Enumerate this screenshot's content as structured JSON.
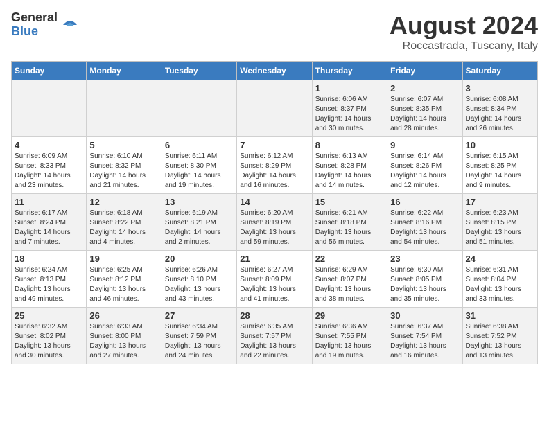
{
  "logo": {
    "general": "General",
    "blue": "Blue"
  },
  "title": "August 2024",
  "subtitle": "Roccastrada, Tuscany, Italy",
  "days_of_week": [
    "Sunday",
    "Monday",
    "Tuesday",
    "Wednesday",
    "Thursday",
    "Friday",
    "Saturday"
  ],
  "weeks": [
    {
      "days": [
        {
          "number": "",
          "info": ""
        },
        {
          "number": "",
          "info": ""
        },
        {
          "number": "",
          "info": ""
        },
        {
          "number": "",
          "info": ""
        },
        {
          "number": "1",
          "info": "Sunrise: 6:06 AM\nSunset: 8:37 PM\nDaylight: 14 hours\nand 30 minutes."
        },
        {
          "number": "2",
          "info": "Sunrise: 6:07 AM\nSunset: 8:35 PM\nDaylight: 14 hours\nand 28 minutes."
        },
        {
          "number": "3",
          "info": "Sunrise: 6:08 AM\nSunset: 8:34 PM\nDaylight: 14 hours\nand 26 minutes."
        }
      ]
    },
    {
      "days": [
        {
          "number": "4",
          "info": "Sunrise: 6:09 AM\nSunset: 8:33 PM\nDaylight: 14 hours\nand 23 minutes."
        },
        {
          "number": "5",
          "info": "Sunrise: 6:10 AM\nSunset: 8:32 PM\nDaylight: 14 hours\nand 21 minutes."
        },
        {
          "number": "6",
          "info": "Sunrise: 6:11 AM\nSunset: 8:30 PM\nDaylight: 14 hours\nand 19 minutes."
        },
        {
          "number": "7",
          "info": "Sunrise: 6:12 AM\nSunset: 8:29 PM\nDaylight: 14 hours\nand 16 minutes."
        },
        {
          "number": "8",
          "info": "Sunrise: 6:13 AM\nSunset: 8:28 PM\nDaylight: 14 hours\nand 14 minutes."
        },
        {
          "number": "9",
          "info": "Sunrise: 6:14 AM\nSunset: 8:26 PM\nDaylight: 14 hours\nand 12 minutes."
        },
        {
          "number": "10",
          "info": "Sunrise: 6:15 AM\nSunset: 8:25 PM\nDaylight: 14 hours\nand 9 minutes."
        }
      ]
    },
    {
      "days": [
        {
          "number": "11",
          "info": "Sunrise: 6:17 AM\nSunset: 8:24 PM\nDaylight: 14 hours\nand 7 minutes."
        },
        {
          "number": "12",
          "info": "Sunrise: 6:18 AM\nSunset: 8:22 PM\nDaylight: 14 hours\nand 4 minutes."
        },
        {
          "number": "13",
          "info": "Sunrise: 6:19 AM\nSunset: 8:21 PM\nDaylight: 14 hours\nand 2 minutes."
        },
        {
          "number": "14",
          "info": "Sunrise: 6:20 AM\nSunset: 8:19 PM\nDaylight: 13 hours\nand 59 minutes."
        },
        {
          "number": "15",
          "info": "Sunrise: 6:21 AM\nSunset: 8:18 PM\nDaylight: 13 hours\nand 56 minutes."
        },
        {
          "number": "16",
          "info": "Sunrise: 6:22 AM\nSunset: 8:16 PM\nDaylight: 13 hours\nand 54 minutes."
        },
        {
          "number": "17",
          "info": "Sunrise: 6:23 AM\nSunset: 8:15 PM\nDaylight: 13 hours\nand 51 minutes."
        }
      ]
    },
    {
      "days": [
        {
          "number": "18",
          "info": "Sunrise: 6:24 AM\nSunset: 8:13 PM\nDaylight: 13 hours\nand 49 minutes."
        },
        {
          "number": "19",
          "info": "Sunrise: 6:25 AM\nSunset: 8:12 PM\nDaylight: 13 hours\nand 46 minutes."
        },
        {
          "number": "20",
          "info": "Sunrise: 6:26 AM\nSunset: 8:10 PM\nDaylight: 13 hours\nand 43 minutes."
        },
        {
          "number": "21",
          "info": "Sunrise: 6:27 AM\nSunset: 8:09 PM\nDaylight: 13 hours\nand 41 minutes."
        },
        {
          "number": "22",
          "info": "Sunrise: 6:29 AM\nSunset: 8:07 PM\nDaylight: 13 hours\nand 38 minutes."
        },
        {
          "number": "23",
          "info": "Sunrise: 6:30 AM\nSunset: 8:05 PM\nDaylight: 13 hours\nand 35 minutes."
        },
        {
          "number": "24",
          "info": "Sunrise: 6:31 AM\nSunset: 8:04 PM\nDaylight: 13 hours\nand 33 minutes."
        }
      ]
    },
    {
      "days": [
        {
          "number": "25",
          "info": "Sunrise: 6:32 AM\nSunset: 8:02 PM\nDaylight: 13 hours\nand 30 minutes."
        },
        {
          "number": "26",
          "info": "Sunrise: 6:33 AM\nSunset: 8:00 PM\nDaylight: 13 hours\nand 27 minutes."
        },
        {
          "number": "27",
          "info": "Sunrise: 6:34 AM\nSunset: 7:59 PM\nDaylight: 13 hours\nand 24 minutes."
        },
        {
          "number": "28",
          "info": "Sunrise: 6:35 AM\nSunset: 7:57 PM\nDaylight: 13 hours\nand 22 minutes."
        },
        {
          "number": "29",
          "info": "Sunrise: 6:36 AM\nSunset: 7:55 PM\nDaylight: 13 hours\nand 19 minutes."
        },
        {
          "number": "30",
          "info": "Sunrise: 6:37 AM\nSunset: 7:54 PM\nDaylight: 13 hours\nand 16 minutes."
        },
        {
          "number": "31",
          "info": "Sunrise: 6:38 AM\nSunset: 7:52 PM\nDaylight: 13 hours\nand 13 minutes."
        }
      ]
    }
  ]
}
